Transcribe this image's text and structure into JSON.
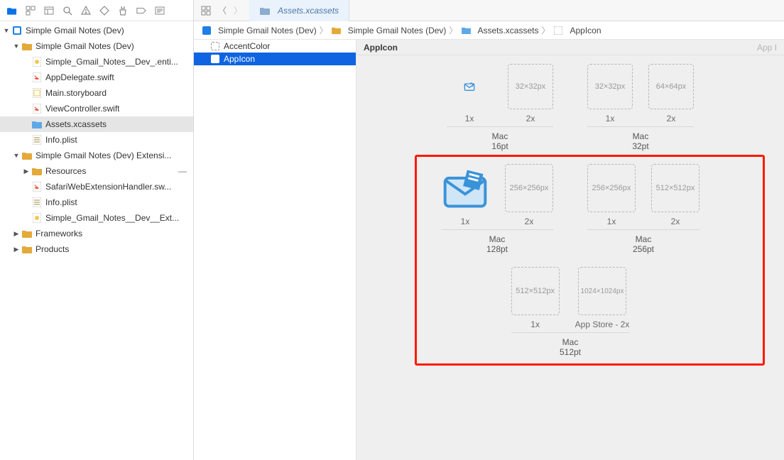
{
  "toolbar": {},
  "navigator": {
    "root": "Simple Gmail Notes (Dev)",
    "items": [
      {
        "label": "Simple Gmail Notes (Dev)"
      },
      {
        "label": "Simple_Gmail_Notes__Dev_.enti..."
      },
      {
        "label": "AppDelegate.swift"
      },
      {
        "label": "Main.storyboard"
      },
      {
        "label": "ViewController.swift"
      },
      {
        "label": "Assets.xcassets"
      },
      {
        "label": "Info.plist"
      },
      {
        "label": "Simple Gmail Notes (Dev) Extensi..."
      },
      {
        "label": "Resources"
      },
      {
        "label": "SafariWebExtensionHandler.sw..."
      },
      {
        "label": "Info.plist"
      },
      {
        "label": "Simple_Gmail_Notes__Dev__Ext..."
      },
      {
        "label": "Frameworks"
      },
      {
        "label": "Products"
      }
    ]
  },
  "tab": {
    "label": "Assets.xcassets"
  },
  "breadcrumbs": [
    "Simple Gmail Notes (Dev)",
    "Simple Gmail Notes (Dev)",
    "Assets.xcassets",
    "AppIcon"
  ],
  "assetList": {
    "accent": "AccentColor",
    "appicon": "AppIcon"
  },
  "editor": {
    "title": "AppIcon",
    "rightFade": "App I",
    "groups": [
      {
        "slots": [
          {
            "scale": "1x",
            "size": 32,
            "filled": true,
            "sizeLabel": ""
          },
          {
            "scale": "2x",
            "size": 64,
            "filled": false,
            "sizeLabel": "32×32px"
          }
        ],
        "title": "Mac",
        "sub": "16pt"
      },
      {
        "slots": [
          {
            "scale": "1x",
            "size": 64,
            "filled": false,
            "sizeLabel": "32×32px"
          },
          {
            "scale": "2x",
            "size": 64,
            "filled": false,
            "sizeLabel": "64×64px"
          }
        ],
        "title": "Mac",
        "sub": "32pt"
      },
      {
        "slots": [
          {
            "scale": "1x",
            "size": 68,
            "filled": true,
            "sizeLabel": ""
          },
          {
            "scale": "2x",
            "size": 68,
            "filled": false,
            "sizeLabel": "256×256px"
          }
        ],
        "title": "Mac",
        "sub": "128pt"
      },
      {
        "slots": [
          {
            "scale": "1x",
            "size": 68,
            "filled": false,
            "sizeLabel": "256×256px"
          },
          {
            "scale": "2x",
            "size": 68,
            "filled": false,
            "sizeLabel": "512×512px"
          }
        ],
        "title": "Mac",
        "sub": "256pt"
      },
      {
        "slots": [
          {
            "scale": "1x",
            "size": 68,
            "filled": false,
            "sizeLabel": "512×512px"
          },
          {
            "scale": "App Store - 2x",
            "size": 68,
            "filled": false,
            "sizeLabel": "1024×1024px"
          }
        ],
        "title": "Mac",
        "sub": "512pt"
      }
    ]
  }
}
